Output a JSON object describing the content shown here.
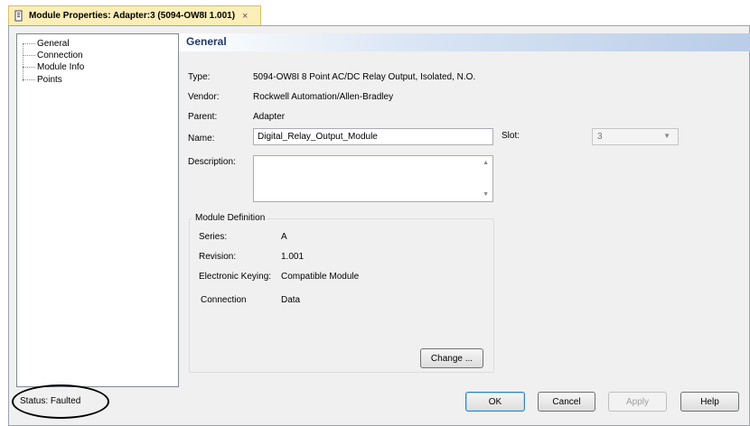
{
  "tab": {
    "title": "Module Properties: Adapter:3 (5094-OW8I 1.001)",
    "close": "×"
  },
  "tree": {
    "items": [
      "General",
      "Connection",
      "Module Info",
      "Points"
    ]
  },
  "header": {
    "title": "General"
  },
  "general": {
    "type_label": "Type:",
    "type_value": "5094-OW8I 8 Point AC/DC Relay Output, Isolated, N.O.",
    "vendor_label": "Vendor:",
    "vendor_value": "Rockwell Automation/Allen-Bradley",
    "parent_label": "Parent:",
    "parent_value": "Adapter",
    "name_label": "Name:",
    "name_value": "Digital_Relay_Output_Module",
    "slot_label": "Slot:",
    "slot_value": "3",
    "description_label": "Description:",
    "description_value": ""
  },
  "module_definition": {
    "title": "Module Definition",
    "series_label": "Series:",
    "series_value": "A",
    "revision_label": "Revision:",
    "revision_value": "1.001",
    "keying_label": "Electronic Keying:",
    "keying_value": "Compatible Module",
    "connection_label": "Connection",
    "connection_value": "Data",
    "change_label": "Change ..."
  },
  "status": {
    "text": "Status:  Faulted"
  },
  "buttons": {
    "ok": "OK",
    "cancel": "Cancel",
    "apply": "Apply",
    "help": "Help"
  },
  "colors": {
    "tab_bg": "#fbeeb8",
    "header_title": "#1e3a6e",
    "window_bg": "#f0f0f0"
  }
}
